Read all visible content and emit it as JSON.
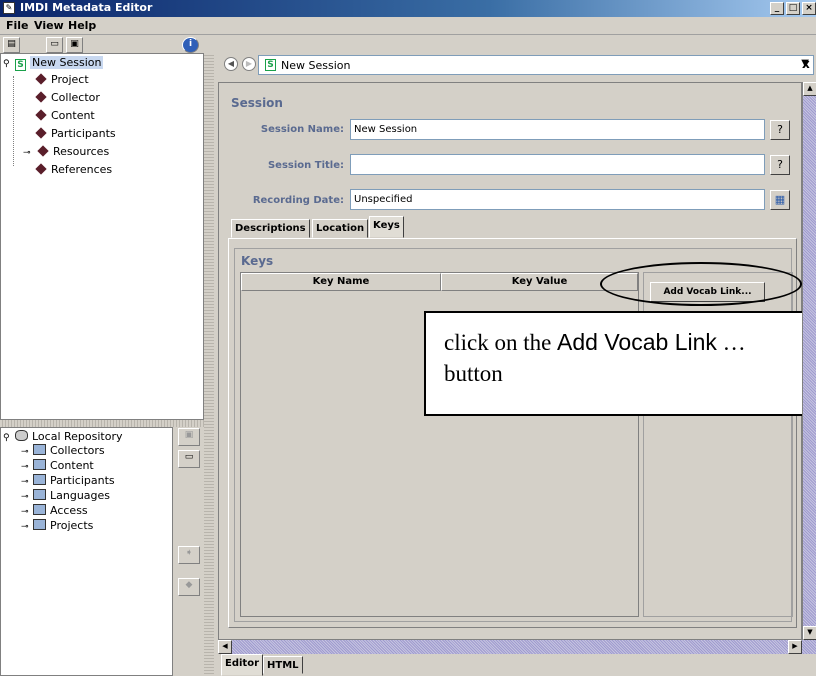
{
  "window": {
    "title": "IMDI Metadata Editor",
    "minimize": "_",
    "maximize": "□",
    "close": "×"
  },
  "menu": {
    "file": "File",
    "view": "View",
    "help": "Help"
  },
  "session_tree": {
    "root": "New Session",
    "items": [
      "Project",
      "Collector",
      "Content",
      "Participants",
      "Resources",
      "References"
    ]
  },
  "repository_tree": {
    "root": "Local Repository",
    "items": [
      "Collectors",
      "Content",
      "Participants",
      "Languages",
      "Access",
      "Projects"
    ]
  },
  "nav": {
    "current": "New Session",
    "close": "x"
  },
  "session_form": {
    "section_title": "Session",
    "name_label": "Session Name:",
    "name_value": "New Session",
    "title_label": "Session Title:",
    "title_value": "",
    "date_label": "Recording Date:",
    "date_value": "Unspecified"
  },
  "tabs": [
    "Descriptions",
    "Location",
    "Keys"
  ],
  "active_tab": "Keys",
  "keys_panel": {
    "title": "Keys",
    "columns": [
      "Key Name",
      "Key Value"
    ],
    "add_vocab_button": "Add Vocab Link..."
  },
  "callout": {
    "part1": "click on the ",
    "part2": "Add Vocab Link",
    "part3": " … button"
  },
  "bottom_tabs": [
    "Editor",
    "HTML"
  ],
  "colors": {
    "label_blue": "#5a6a90",
    "title_bar": "#0a246a",
    "item_diamond": "#5a1e2a",
    "session_green": "#1aa04a"
  }
}
